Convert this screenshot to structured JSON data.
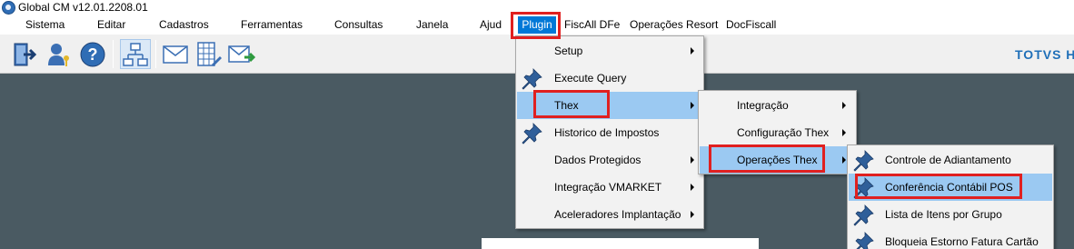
{
  "window": {
    "title": "Global CM v12.01.2208.01",
    "app_icon": "globe-icon"
  },
  "menubar": {
    "items": [
      "Sistema",
      "Editar",
      "Cadastros",
      "Ferramentas",
      "Consultas",
      "Janela",
      "Ajud",
      "Plugin",
      "FiscAll DFe",
      "Operações Resort",
      "DocFiscall"
    ]
  },
  "toolbar": {
    "buttons": [
      "exit-icon",
      "user-key-icon",
      "help-icon",
      "org-chart-icon",
      "mail-icon",
      "spreadsheet-edit-icon",
      "mail-send-icon"
    ],
    "brand": "TOTVS H"
  },
  "plugin_menu": {
    "items": [
      {
        "label": "Setup",
        "icon": "",
        "submenu": true
      },
      {
        "label": "Execute Query",
        "icon": "pushpin-icon",
        "submenu": false
      },
      {
        "label": "Thex",
        "icon": "",
        "submenu": true
      },
      {
        "label": "Historico de Impostos",
        "icon": "pushpin-icon",
        "submenu": false
      },
      {
        "label": "Dados Protegidos",
        "icon": "",
        "submenu": true
      },
      {
        "label": "Integração VMARKET",
        "icon": "",
        "submenu": true
      },
      {
        "label": "Aceleradores Implantação",
        "icon": "",
        "submenu": true
      }
    ]
  },
  "thex_menu": {
    "items": [
      {
        "label": "Integração",
        "submenu": true
      },
      {
        "label": "Configuração Thex",
        "submenu": true
      },
      {
        "label": "Operações Thex",
        "submenu": true
      }
    ]
  },
  "operacoes_menu": {
    "items": [
      {
        "label": "Controle de Adiantamento",
        "icon": "pushpin-icon"
      },
      {
        "label": "Conferência Contábil POS",
        "icon": "pushpin-icon"
      },
      {
        "label": "Lista de Itens por Grupo",
        "icon": "pushpin-icon"
      },
      {
        "label": "Bloqueia Estorno Fatura Cartão",
        "icon": "pushpin-icon"
      }
    ]
  },
  "colors": {
    "highlight": "#0078d7",
    "hover": "#9bc9f2",
    "annotation": "#e02020",
    "workspace": "#4a5a62",
    "brand": "#1f6fb8"
  }
}
